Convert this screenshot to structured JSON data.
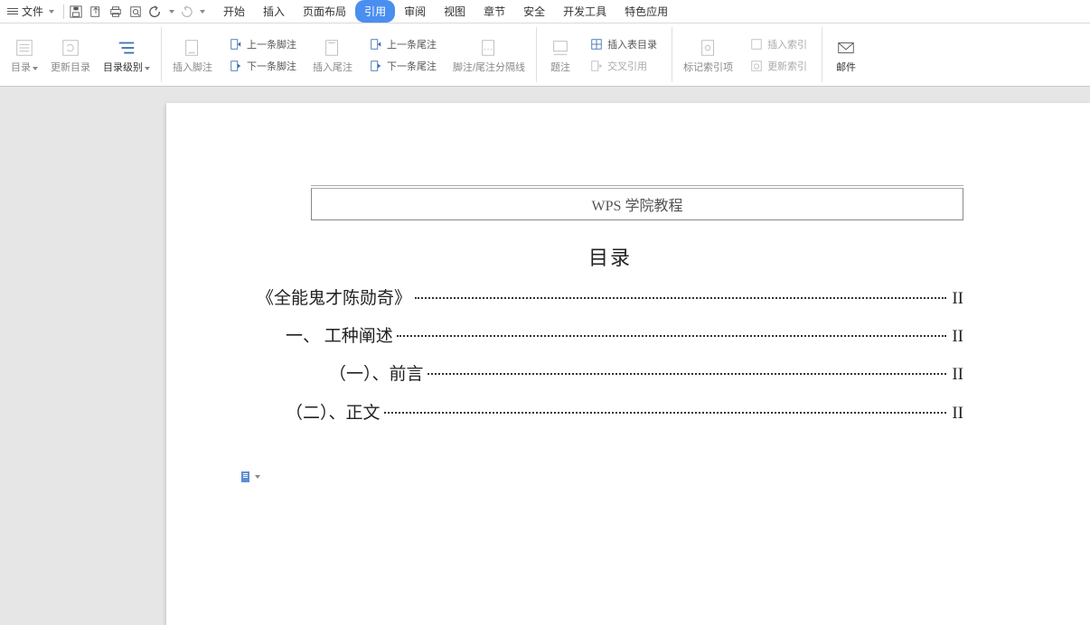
{
  "menubar": {
    "file_label": "文件",
    "tabs": [
      "开始",
      "插入",
      "页面布局",
      "引用",
      "审阅",
      "视图",
      "章节",
      "安全",
      "开发工具",
      "特色应用"
    ],
    "active_tab_index": 3
  },
  "ribbon": {
    "toc": {
      "directory": "目录",
      "update_directory": "更新目录",
      "directory_level": "目录级别"
    },
    "footnote": {
      "insert_footnote": "插入脚注",
      "prev_footnote": "上一条脚注",
      "next_footnote": "下一条脚注",
      "insert_endnote": "插入尾注",
      "prev_endnote": "上一条尾注",
      "next_endnote": "下一条尾注",
      "separator": "脚注/尾注分隔线"
    },
    "caption": {
      "caption": "题注",
      "insert_fig_table": "插入表目录",
      "cross_ref": "交叉引用"
    },
    "index": {
      "mark_entry": "标记索引项",
      "insert_index": "插入索引",
      "update_index": "更新索引"
    },
    "mail": {
      "mail": "邮件"
    }
  },
  "document": {
    "header_text": "WPS 学院教程",
    "toc_title": "目录",
    "items": [
      {
        "text": "《全能鬼才陈勋奇》",
        "page": "II",
        "indent": 0
      },
      {
        "text": "一、 工种阐述",
        "page": "II",
        "indent": 1
      },
      {
        "text": "（一）、前言",
        "page": "II",
        "indent": 2
      },
      {
        "text": "（二）、正文",
        "page": "II",
        "indent": 3
      }
    ]
  }
}
